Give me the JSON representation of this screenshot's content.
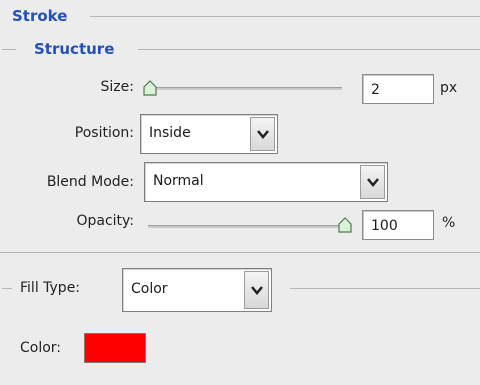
{
  "stroke": {
    "title": "Stroke"
  },
  "structure": {
    "title": "Structure",
    "size": {
      "label": "Size:",
      "value": "2",
      "unit": "px",
      "slider_fraction": 0.02
    },
    "position": {
      "label": "Position:",
      "value": "Inside"
    },
    "blend_mode": {
      "label": "Blend Mode:",
      "value": "Normal"
    },
    "opacity": {
      "label": "Opacity:",
      "value": "100",
      "unit": "%",
      "slider_fraction": 1.0
    }
  },
  "fill": {
    "label": "Fill Type:",
    "value": "Color",
    "color_label": "Color:",
    "color": "#ff0000"
  },
  "icons": {
    "dropdown": "chevron-down-icon",
    "slider": "slider-thumb-icon"
  }
}
